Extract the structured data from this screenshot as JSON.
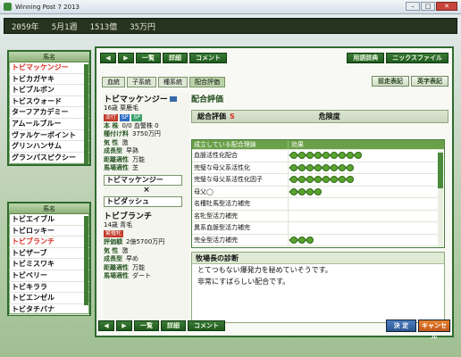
{
  "window": {
    "title": "Winning Post 7 2013"
  },
  "status": {
    "year": "2059年",
    "week": "5月1週",
    "money": "1513億",
    "sub": "35万円"
  },
  "left_top": {
    "header": "馬名",
    "items": [
      "トビマッケンジー",
      "トビカガヤキ",
      "トビブルボン",
      "トビスウォード",
      "ターフアカデミー",
      "アムールブルー",
      "ヴァルケーポイント",
      "グリンハンサム",
      "グランパスピクシー"
    ],
    "selected_index": 0
  },
  "left_bottom": {
    "header": "馬名",
    "items": [
      "トビエイブル",
      "トビロッキー",
      "トビブランチ",
      "トビザーブ",
      "トビミスワキ",
      "トビベリー",
      "トビキララ",
      "トビエンゼル",
      "トビタチバナ"
    ],
    "selected_index": 2
  },
  "toolbar": {
    "back": "◀",
    "forward": "▶",
    "list": "一覧",
    "detail": "詳細",
    "comment": "コメント",
    "dictionary": "用語辞典",
    "nick": "ニックスファイル",
    "prev_eval": "前走表記",
    "eng": "英字表記"
  },
  "tabs": [
    "血統",
    "子系統",
    "種系統",
    "配合評価"
  ],
  "horse": {
    "sire_name": "トビマッケンジー",
    "sire_info": "16歳 栗鹿毛",
    "sire_badges": [
      "流行",
      "SP",
      "SP"
    ],
    "stats": [
      {
        "label": "本  株",
        "value": "0/0 血警株 0"
      },
      {
        "label": "種付け料",
        "value": "3750万円"
      },
      {
        "label": "気  性",
        "value": "激"
      },
      {
        "label": "成長型",
        "value": "早熟"
      },
      {
        "label": "距離適性",
        "value": "万能"
      },
      {
        "label": "馬場適性",
        "value": "芝"
      }
    ],
    "sire_box": "トビマッケンジー",
    "cross": "×",
    "dam_box": "トビダッシュ",
    "dam_name": "トビブランチ",
    "dam_info": "14歳 青毛",
    "dam_badge": "繁殖牝",
    "dam_stats": [
      {
        "label": "評価額",
        "value": "2億5700万円"
      },
      {
        "label": "気  性",
        "value": "激"
      },
      {
        "label": "成長型",
        "value": "早め"
      },
      {
        "label": "距離適性",
        "value": "万能"
      },
      {
        "label": "馬場適性",
        "value": "ダート"
      }
    ]
  },
  "evaluation": {
    "title": "配合評価",
    "total_label": "総合評価",
    "total_value": "S",
    "risk_label": "危険度",
    "col1": "成立している配合理論",
    "col2": "効果",
    "rows": [
      {
        "name": "血脈活性化配合",
        "clovers": 9
      },
      {
        "name": "完璧な母父系活性化",
        "clovers": 8
      },
      {
        "name": "完璧な母父系活性化因子",
        "clovers": 8
      },
      {
        "name": "母父◯",
        "clovers": 4
      },
      {
        "name": "名種牡馬型活力補完",
        "clovers": 0
      },
      {
        "name": "名牝型活力補完",
        "clovers": 0
      },
      {
        "name": "異系血脈型活力補完",
        "clovers": 0
      },
      {
        "name": "完全型活力補完",
        "clovers": 3
      }
    ]
  },
  "diagnosis": {
    "title": "牧場長の診断",
    "lines": [
      "とてつもない爆発力を秘めていそうです。",
      "非常にすばらしい配合です。"
    ]
  },
  "bottom": {
    "ok": "決 定",
    "cancel": "キャンセル"
  },
  "colors": {
    "accent": "#2f6b2f",
    "selected": "#d62b20",
    "clover": "#5aa32f"
  }
}
